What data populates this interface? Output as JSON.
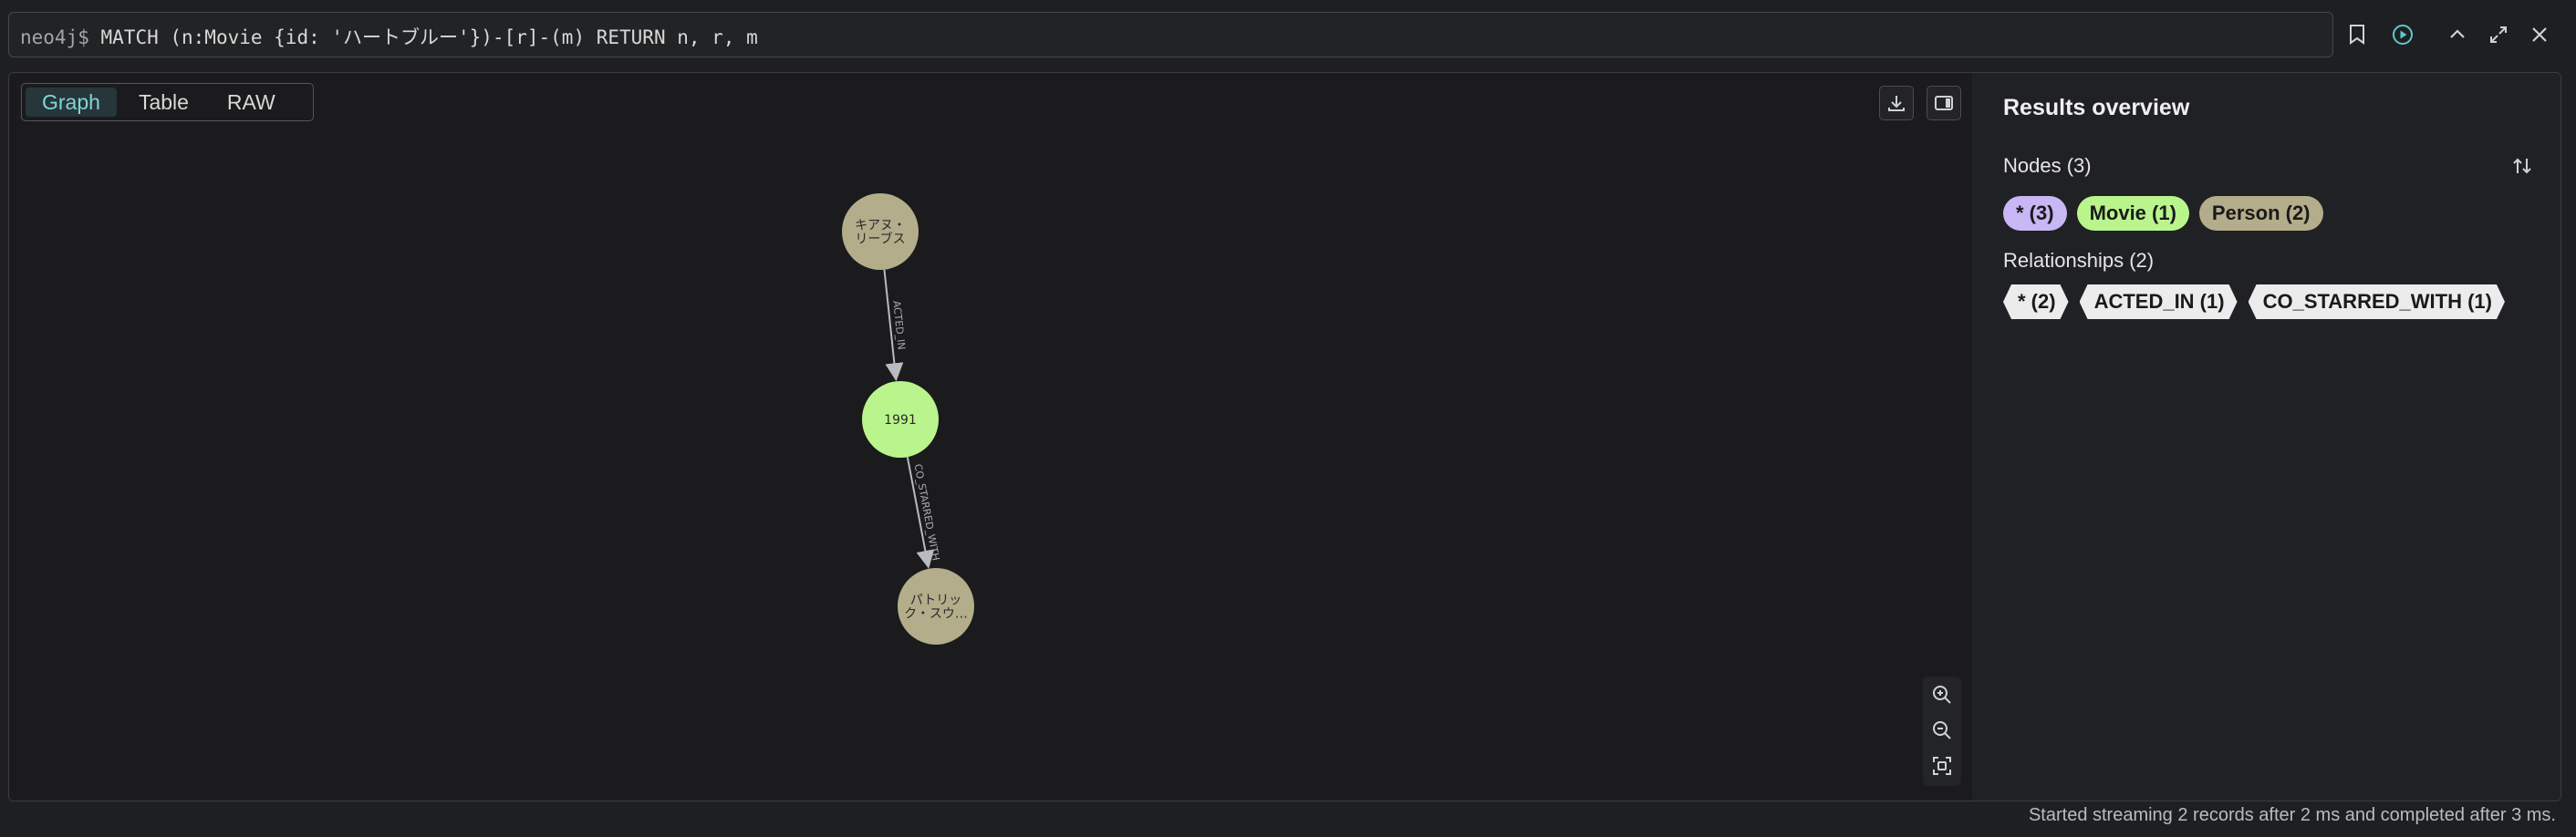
{
  "query": {
    "prompt": "neo4j$",
    "text": "MATCH (n:Movie {id: 'ハートブルー'})-[r]-(m) RETURN n, r, m"
  },
  "icons": {
    "bookmark": "bookmark-icon",
    "run": "run-icon",
    "collapse": "chevron-up-icon",
    "fullscreen": "expand-icon",
    "close": "close-icon",
    "download": "download-icon",
    "toggle_panel": "side-panel-icon",
    "zoom_in": "zoom-in-icon",
    "zoom_out": "zoom-out-icon",
    "fit": "fit-to-screen-icon",
    "sort": "sort-icon"
  },
  "view_tabs": [
    {
      "label": "Graph",
      "active": true
    },
    {
      "label": "Table",
      "active": false
    },
    {
      "label": "RAW",
      "active": false
    }
  ],
  "graph": {
    "nodes": [
      {
        "id": "keanu",
        "lines": [
          "キアヌ・",
          "リーブス"
        ],
        "color": "#b3ad8b"
      },
      {
        "id": "movie",
        "lines": [
          "1991"
        ],
        "color": "#b9f58c"
      },
      {
        "id": "patrick",
        "lines": [
          "パトリッ",
          "ク・スウ…"
        ],
        "color": "#b3ad8b"
      }
    ],
    "relationships": [
      {
        "from": "keanu",
        "to": "movie",
        "label": "ACTED_IN"
      },
      {
        "from": "movie",
        "to": "patrick",
        "label": "CO_STARRED_WITH"
      }
    ]
  },
  "overview": {
    "title": "Results overview",
    "nodes_heading": "Nodes (3)",
    "node_chips": [
      {
        "label": "* (3)",
        "color": "#c9b6f5"
      },
      {
        "label": "Movie (1)",
        "color": "#b9f58c"
      },
      {
        "label": "Person (2)",
        "color": "#b3ad8b"
      }
    ],
    "relationships_heading": "Relationships (2)",
    "rel_chips": [
      {
        "label": "* (2)"
      },
      {
        "label": "ACTED_IN (1)"
      },
      {
        "label": "CO_STARRED_WITH (1)"
      }
    ]
  },
  "status": "Started streaming 2 records after 2 ms and completed after 3 ms."
}
